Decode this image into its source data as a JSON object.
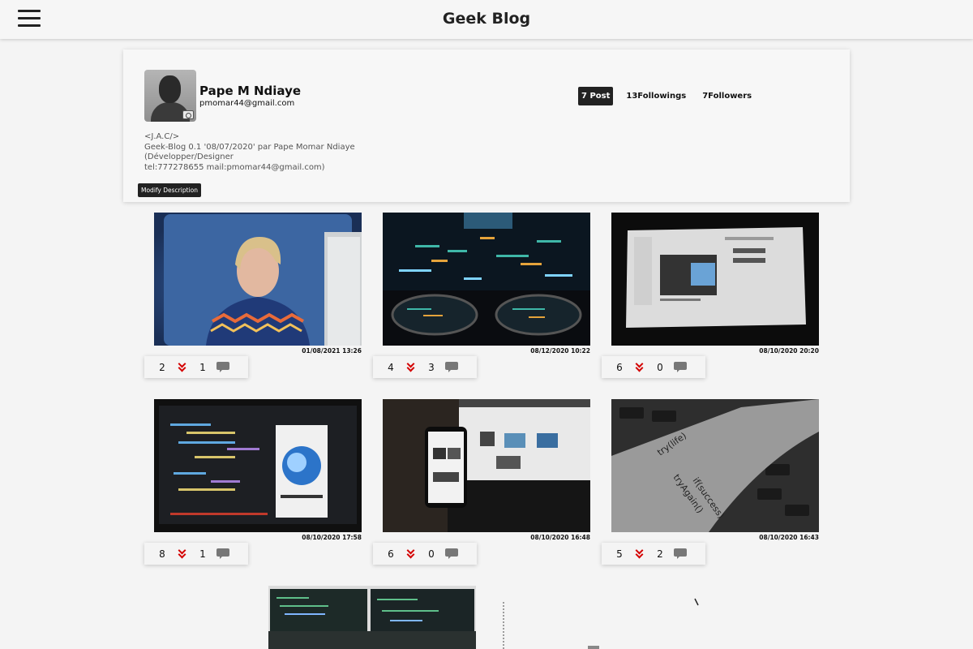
{
  "header": {
    "title": "Geek Blog",
    "menu_icon": "hamburger-menu-icon"
  },
  "profile": {
    "name": "Pape M Ndiaye",
    "email": "pmomar44@gmail.com",
    "stats": {
      "posts": "7 Post",
      "followings": "13Followings",
      "followers": "7Followers"
    },
    "description": [
      "<J.A.C/>",
      "Geek-Blog 0.1 '08/07/2020' par Pape Momar Ndiaye",
      "(Développer/Designer",
      "tel:777278655 mail:pmomar44@gmail.com)"
    ],
    "modify_button": "Modify Description"
  },
  "posts": [
    {
      "date": "01/08/2021 13:26",
      "votes": "2",
      "comments": "1"
    },
    {
      "date": "08/12/2020 10:22",
      "votes": "4",
      "comments": "3"
    },
    {
      "date": "08/10/2020 20:20",
      "votes": "6",
      "comments": "0"
    },
    {
      "date": "08/10/2020 17:58",
      "votes": "8",
      "comments": "1"
    },
    {
      "date": "08/10/2020 16:48",
      "votes": "6",
      "comments": "0"
    },
    {
      "date": "08/10/2020 16:43",
      "votes": "5",
      "comments": "2"
    }
  ],
  "colors": {
    "accent": "#222222",
    "downvote": "#d40000",
    "comment_icon": "#777777"
  }
}
